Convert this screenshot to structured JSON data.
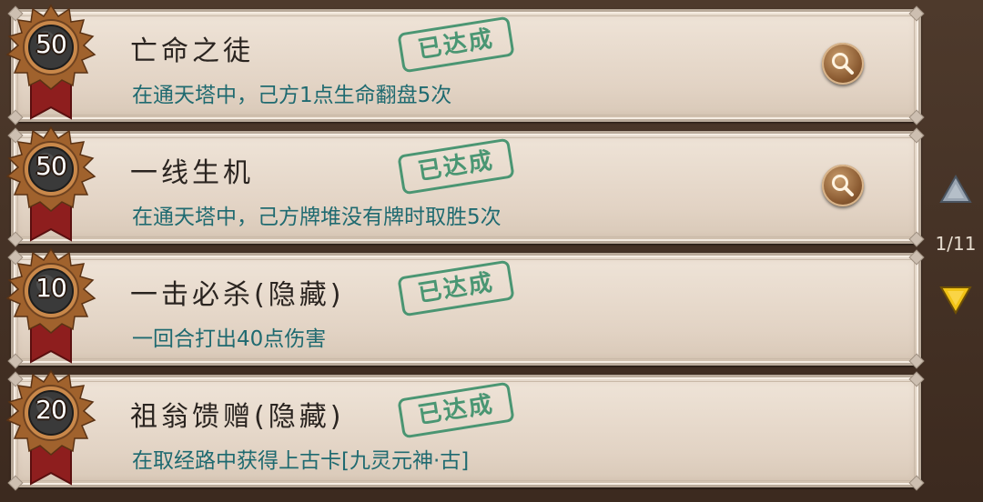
{
  "achievements": [
    {
      "points": "50",
      "title": "亡命之徒",
      "desc": "在通天塔中，己方1点生命翻盘5次",
      "stamp": "已达成",
      "has_search": true
    },
    {
      "points": "50",
      "title": "一线生机",
      "desc": "在通天塔中，己方牌堆没有牌时取胜5次",
      "stamp": "已达成",
      "has_search": true
    },
    {
      "points": "10",
      "title": "一击必杀(隐藏)",
      "desc": "一回合打出40点伤害",
      "stamp": "已达成",
      "has_search": false
    },
    {
      "points": "20",
      "title": "祖翁馈赠(隐藏)",
      "desc": "在取经路中获得上古卡[九灵元神·古]",
      "stamp": "已达成",
      "has_search": false
    }
  ],
  "pagination": {
    "page": "1/11"
  },
  "icons": {
    "badge": "laurel-medal-icon",
    "search": "magnifier-icon",
    "up": "triangle-up-icon",
    "down": "triangle-down-icon"
  },
  "colors": {
    "desc_text": "#1f6a70",
    "stamp": "#2f8a63",
    "ribbon": "#8e1e1e",
    "arrow_down": "#f2c416",
    "arrow_up": "#9aa5b2"
  }
}
